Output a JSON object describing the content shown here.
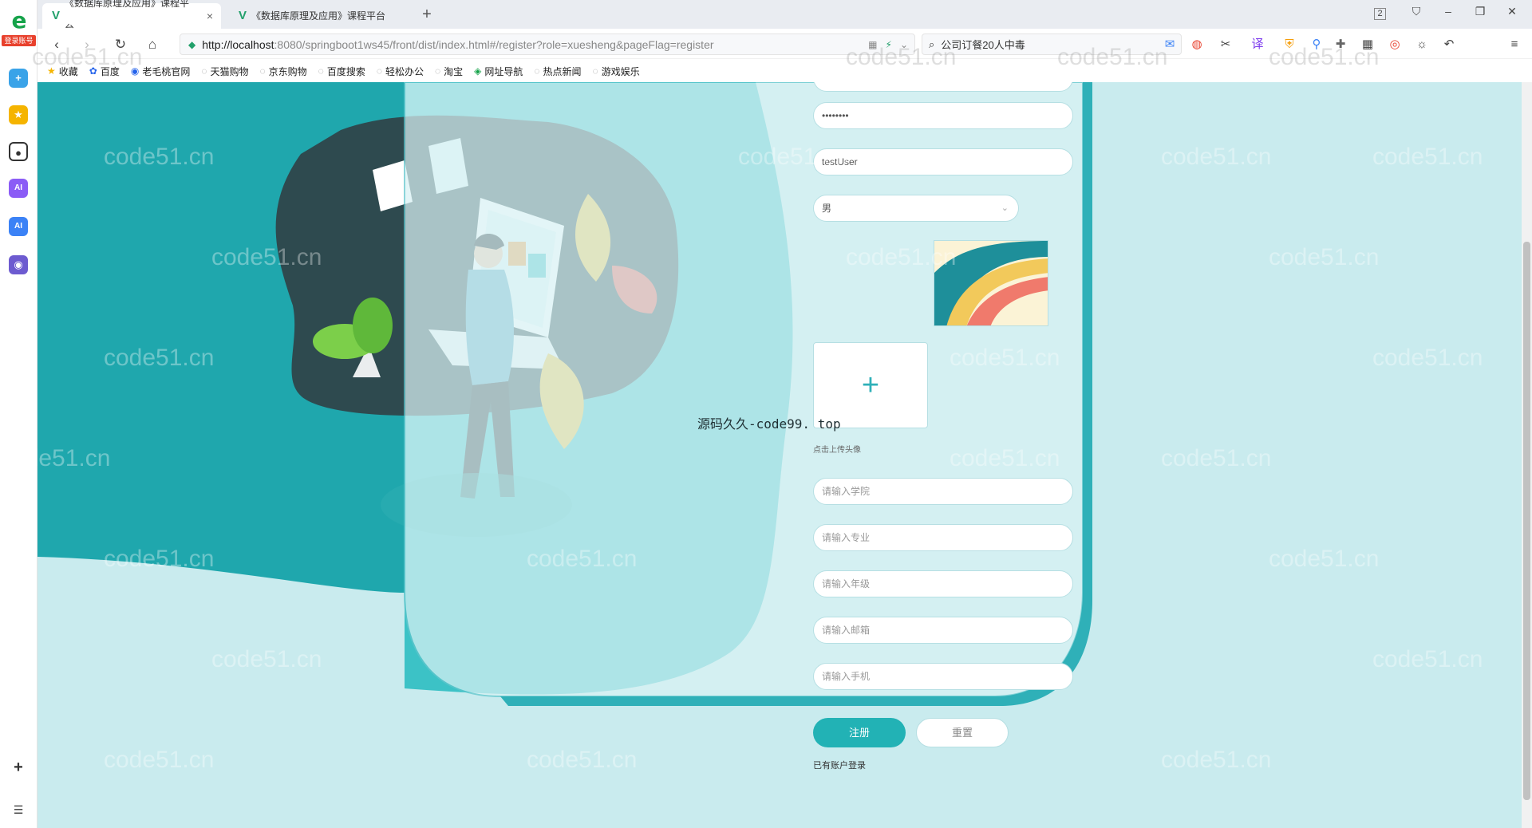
{
  "browser": {
    "rail_badge": "登录账号",
    "tabs": [
      {
        "title": "《数据库原理及应用》课程平台",
        "active": true
      },
      {
        "title": "《数据库原理及应用》课程平台",
        "active": false
      }
    ],
    "window_counter": "2",
    "url_host": "http://localhost",
    "url_rest": ":8080/springboot1ws45/front/dist/index.html#/register?role=xuesheng&pageFlag=register",
    "search_text": "公司订餐20人中毒",
    "bookmarks": [
      "收藏",
      "百度",
      "老毛桃官网",
      "天猫购物",
      "京东购物",
      "百度搜索",
      "轻松办公",
      "淘宝",
      "网址导航",
      "热点新闻",
      "游戏娱乐"
    ]
  },
  "form": {
    "password_value": "••••••••",
    "name_value": "testUser",
    "gender_value": "男",
    "upload_hint": "点击上传头像",
    "college_placeholder": "请输入学院",
    "major_placeholder": "请输入专业",
    "grade_placeholder": "请输入年级",
    "email_placeholder": "请输入邮箱",
    "phone_placeholder": "请输入手机",
    "register_label": "注册",
    "reset_label": "重置",
    "login_link": "已有账户登录"
  },
  "overlay": "源码久久-code99. top",
  "watermark": "code51.cn",
  "colors": {
    "accent": "#22b2b5",
    "page_bg": "#c9ebee",
    "illustration_dark": "#2e4a4f"
  }
}
